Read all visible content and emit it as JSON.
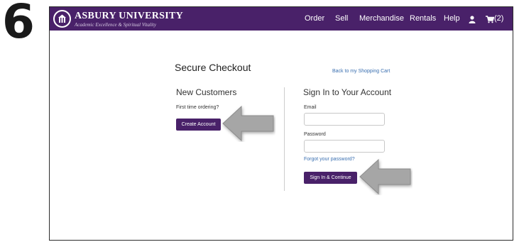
{
  "step_number": "6",
  "header": {
    "university_name": "ASBURY UNIVERSITY",
    "tagline": "Academic Excellence & Spiritual Vitality",
    "nav": [
      {
        "label": "Order"
      },
      {
        "label": "Sell"
      },
      {
        "label": "Merchandise"
      },
      {
        "label": "Rentals"
      },
      {
        "label": "Help"
      }
    ],
    "user_icon": "user-icon",
    "cart_icon": "cart-icon",
    "cart_count": "(2)"
  },
  "checkout": {
    "title": "Secure Checkout",
    "back_link": "Back to my Shopping Cart",
    "new_customers": {
      "heading": "New Customers",
      "prompt": "First time ordering?",
      "button": "Create Account"
    },
    "sign_in": {
      "heading": "Sign In to Your Account",
      "email_label": "Email",
      "email_value": "",
      "password_label": "Password",
      "password_value": "",
      "forgot_link": "Forgot your password?",
      "button": "Sign In & Continue"
    }
  },
  "colors": {
    "brand_purple": "#492169",
    "link_blue": "#3a6fb0",
    "arrow_gray": "#a6a6a6"
  }
}
